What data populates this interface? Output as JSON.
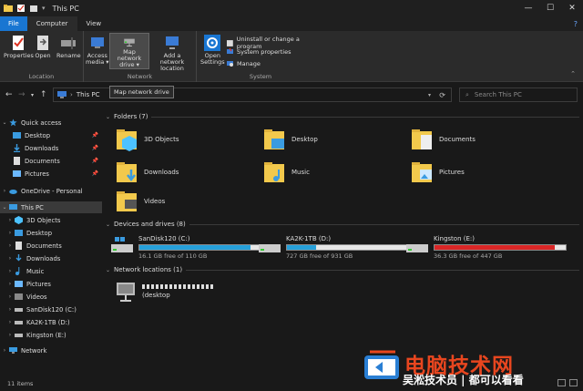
{
  "window": {
    "title": "This PC",
    "controls": {
      "minimize": "—",
      "maximize": "☐",
      "close": "✕"
    }
  },
  "ribbon_tabs": [
    "File",
    "Computer",
    "View"
  ],
  "ribbon": {
    "location": {
      "label": "Location",
      "buttons": [
        "Properties",
        "Open",
        "Rename"
      ]
    },
    "network": {
      "label": "Network",
      "access_media": [
        "Access",
        "media ▾"
      ],
      "map_drive": [
        "Map network",
        "drive ▾"
      ],
      "add_location": [
        "Add a network",
        "location"
      ]
    },
    "system": {
      "label": "System",
      "open_settings": [
        "Open",
        "Settings"
      ],
      "items": [
        "Uninstall or change a program",
        "System properties",
        "Manage"
      ]
    }
  },
  "tooltip": "Map network drive",
  "address": {
    "path": "This PC",
    "search_placeholder": "Search This PC"
  },
  "nav": {
    "quick_access": "Quick access",
    "quick_items": [
      "Desktop",
      "Downloads",
      "Documents",
      "Pictures"
    ],
    "onedrive": "OneDrive - Personal",
    "this_pc": "This PC",
    "pc_items": [
      "3D Objects",
      "Desktop",
      "Documents",
      "Downloads",
      "Music",
      "Pictures",
      "Videos",
      "SanDisk120 (C:)",
      "KA2K-1TB (D:)",
      "Kingston (E:)"
    ],
    "network": "Network"
  },
  "folders": {
    "header": "Folders (7)",
    "items": [
      "3D Objects",
      "Desktop",
      "Documents",
      "Downloads",
      "Music",
      "Pictures",
      "Videos"
    ]
  },
  "drives": {
    "header": "Devices and drives (8)",
    "items": [
      {
        "name": "SanDisk120 (C:)",
        "free": "16.1 GB free of 110 GB",
        "used_fraction": 0.85,
        "color": "#26a0da"
      },
      {
        "name": "KA2K-1TB (D:)",
        "free": "727 GB free of 931 GB",
        "used_fraction": 0.22,
        "color": "#26a0da"
      },
      {
        "name": "Kingston (E:)",
        "free": "36.3 GB free of 447 GB",
        "used_fraction": 0.92,
        "color": "#da2626"
      }
    ]
  },
  "network_locations": {
    "header": "Network locations (1)",
    "item_label": "(desktop"
  },
  "status": {
    "items_count": "11 items"
  },
  "watermark": {
    "title": "电脑技术网",
    "subtitle": "吴淞技术员 | 都可以看看"
  }
}
